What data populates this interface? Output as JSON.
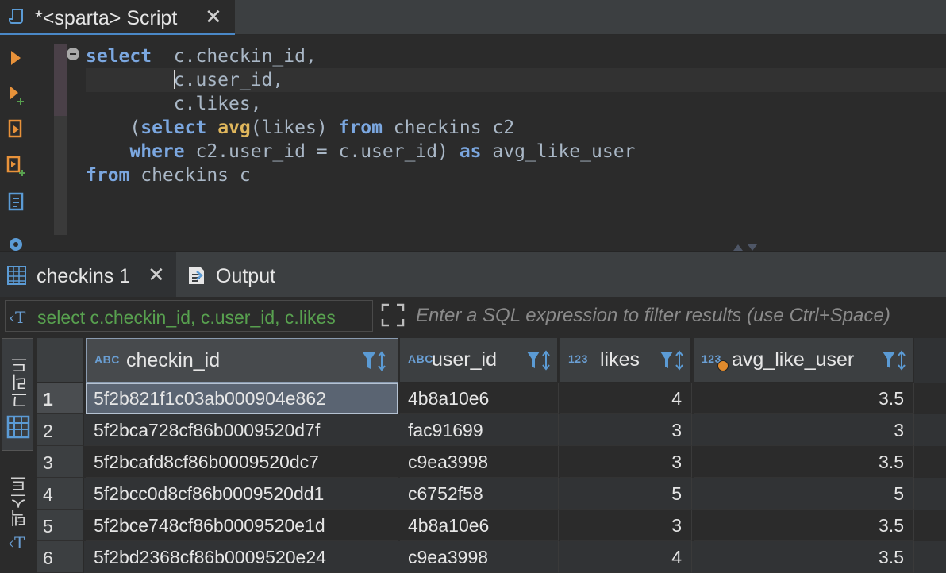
{
  "editor_tab": {
    "title": "*<sparta> Script",
    "close_glyph": "✕"
  },
  "sql_lines": [
    {
      "indent": "",
      "parts": [
        {
          "t": "kw",
          "v": "select"
        },
        {
          "t": "id",
          "v": "  c.checkin_id,"
        }
      ]
    },
    {
      "indent": "        ",
      "parts": [
        {
          "t": "caret",
          "v": ""
        },
        {
          "t": "id",
          "v": "c.user_id,"
        }
      ]
    },
    {
      "indent": "        ",
      "parts": [
        {
          "t": "id",
          "v": "c.likes,"
        }
      ]
    },
    {
      "indent": "    ",
      "parts": [
        {
          "t": "id",
          "v": "("
        },
        {
          "t": "kw",
          "v": "select"
        },
        {
          "t": "id",
          "v": " "
        },
        {
          "t": "fn",
          "v": "avg"
        },
        {
          "t": "id",
          "v": "(likes) "
        },
        {
          "t": "kw",
          "v": "from"
        },
        {
          "t": "id",
          "v": " checkins c2"
        }
      ]
    },
    {
      "indent": "    ",
      "parts": [
        {
          "t": "kw",
          "v": "where"
        },
        {
          "t": "id",
          "v": " c2.user_id = c.user_id) "
        },
        {
          "t": "kw",
          "v": "as"
        },
        {
          "t": "id",
          "v": " avg_like_user"
        }
      ]
    },
    {
      "indent": "",
      "parts": [
        {
          "t": "kw",
          "v": "from"
        },
        {
          "t": "id",
          "v": " checkins c"
        }
      ]
    }
  ],
  "results_tabs": {
    "active_label": "checkins 1",
    "close_glyph": "✕",
    "output_label": "Output"
  },
  "filter": {
    "icon_glyph": "‹T",
    "sql_text": "select c.checkin_id, c.user_id, c.likes",
    "placeholder": "Enter a SQL expression to filter results (use Ctrl+Space)"
  },
  "side_tabs": {
    "grid_label": "그리드",
    "text_label": "텍스트",
    "text_icon_glyph": "‹T"
  },
  "grid": {
    "columns": [
      {
        "type_badge": "ABC",
        "label": "checkin_id"
      },
      {
        "type_badge": "ABC",
        "label": "user_id"
      },
      {
        "type_badge": "123",
        "label": "likes"
      },
      {
        "type_badge": "123",
        "label": "avg_like_user"
      }
    ],
    "rows": [
      {
        "num": "1",
        "checkin_id": "5f2b821f1c03ab000904e862",
        "user_id": "4b8a10e6",
        "likes": "4",
        "avg_like_user": "3.5"
      },
      {
        "num": "2",
        "checkin_id": "5f2bca728cf86b0009520d7f",
        "user_id": "fac91699",
        "likes": "3",
        "avg_like_user": "3"
      },
      {
        "num": "3",
        "checkin_id": "5f2bcafd8cf86b0009520dc7",
        "user_id": "c9ea3998",
        "likes": "3",
        "avg_like_user": "3.5"
      },
      {
        "num": "4",
        "checkin_id": "5f2bcc0d8cf86b0009520dd1",
        "user_id": "c6752f58",
        "likes": "5",
        "avg_like_user": "5"
      },
      {
        "num": "5",
        "checkin_id": "5f2bce748cf86b0009520e1d",
        "user_id": "4b8a10e6",
        "likes": "3",
        "avg_like_user": "3.5"
      },
      {
        "num": "6",
        "checkin_id": "5f2bd2368cf86b0009520e24",
        "user_id": "c9ea3998",
        "likes": "4",
        "avg_like_user": "3.5"
      }
    ]
  },
  "colors": {
    "keyword": "#7ba7e0",
    "function": "#e0b75c",
    "identifier": "#a9b7c6",
    "filter_sql": "#58a14f",
    "accent": "#4a88c7",
    "toolbar_orange": "#e8923a",
    "toolbar_blue": "#5b9bd5"
  }
}
